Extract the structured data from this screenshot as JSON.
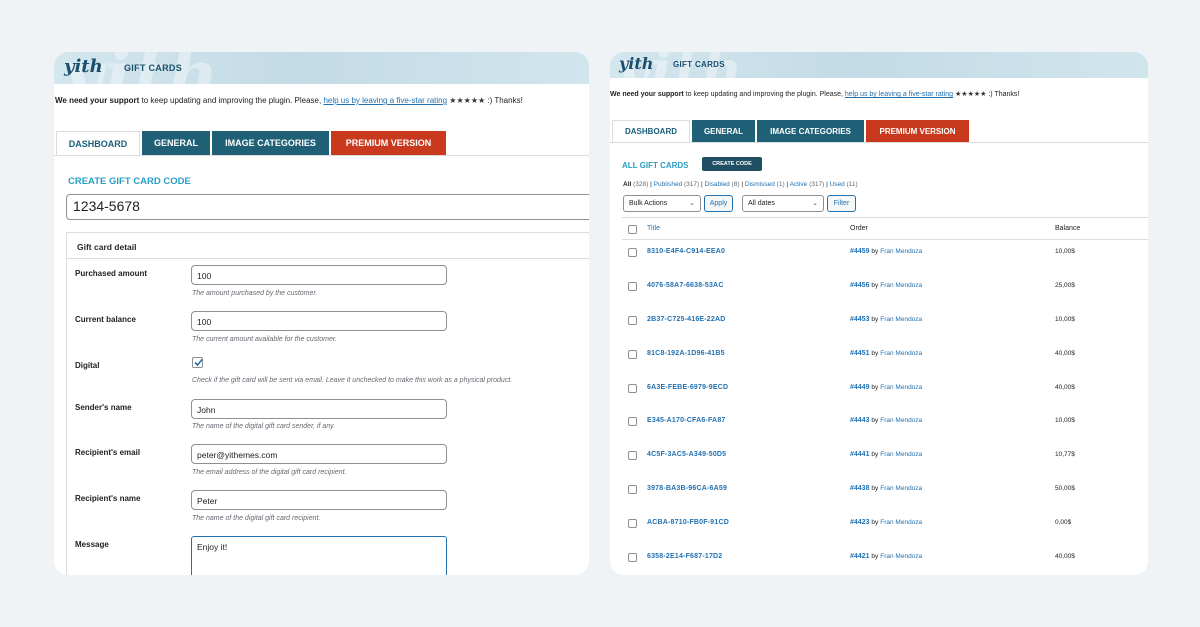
{
  "brand": {
    "logo": "yith",
    "deco": "yith"
  },
  "left": {
    "banner_title": "GIFT CARDS",
    "support": {
      "bold": "We need your support",
      "text": " to keep updating and improving the plugin. Please, ",
      "link": "help us by leaving a five-star rating",
      "stars": "★★★★★",
      "end": " :) Thanks!"
    },
    "tabs": [
      "DASHBOARD",
      "GENERAL",
      "IMAGE CATEGORIES",
      "PREMIUM VERSION"
    ],
    "section_title": "CREATE GIFT CARD CODE",
    "code_value": "1234-5678",
    "detail_title": "Gift card detail",
    "fields": {
      "purchased": {
        "label": "Purchased amount",
        "value": "100",
        "desc": "The amount purchased by the customer."
      },
      "balance": {
        "label": "Current balance",
        "value": "100",
        "desc": "The current amount available for the customer."
      },
      "digital": {
        "label": "Digital",
        "checked": true,
        "desc": "Check if the gift card will be sent via email. Leave it unchecked to make this work as a physical product."
      },
      "sender": {
        "label": "Sender's name",
        "value": "John",
        "desc": "The name of the digital gift card sender, if any."
      },
      "recipient_email": {
        "label": "Recipient's email",
        "value": "peter@yithemes.com",
        "desc": "The email address of the digital gift card recipient."
      },
      "recipient_name": {
        "label": "Recipient's name",
        "value": "Peter",
        "desc": "The name of the digital gift card recipient."
      },
      "message": {
        "label": "Message",
        "value": "Enjoy it!"
      }
    }
  },
  "right": {
    "banner_title": "GIFT CARDS",
    "support": {
      "bold": "We need your support",
      "text": " to keep updating and improving the plugin. Please, ",
      "link": "help us by leaving a five-star rating",
      "stars": "★★★★★",
      "end": " :) Thanks!"
    },
    "tabs": [
      "DASHBOARD",
      "GENERAL",
      "IMAGE CATEGORIES",
      "PREMIUM VERSION"
    ],
    "list_title": "ALL GIFT CARDS",
    "create_button": "CREATE CODE",
    "filters": [
      {
        "label": "All",
        "count": "(328)"
      },
      {
        "label": "Published",
        "count": "(317)"
      },
      {
        "label": "Disabled",
        "count": "(8)"
      },
      {
        "label": "Dismissed",
        "count": "(1)"
      },
      {
        "label": "Active",
        "count": "(317)"
      },
      {
        "label": "Used",
        "count": "(11)"
      }
    ],
    "bulk_actions": "Bulk Actions",
    "apply": "Apply",
    "all_dates": "All dates",
    "filter": "Filter",
    "columns": {
      "title": "Title",
      "order": "Order",
      "balance": "Balance"
    },
    "rows": [
      {
        "code": "8310-E4F4-C914-EEA0",
        "order": "#4459",
        "by": "by",
        "customer": "Fran Mendoza",
        "balance": "10,00$"
      },
      {
        "code": "4076-58A7-6638-53AC",
        "order": "#4456",
        "by": "by",
        "customer": "Fran Mendoza",
        "balance": "25,00$"
      },
      {
        "code": "2B37-C725-416E-22AD",
        "order": "#4453",
        "by": "by",
        "customer": "Fran Mendoza",
        "balance": "10,00$"
      },
      {
        "code": "81C8-192A-1D96-41B5",
        "order": "#4451",
        "by": "by",
        "customer": "Fran Mendoza",
        "balance": "40,00$"
      },
      {
        "code": "6A3E-FEBE-6979-9ECD",
        "order": "#4449",
        "by": "by",
        "customer": "Fran Mendoza",
        "balance": "40,00$"
      },
      {
        "code": "E345-A170-CFA6-FA87",
        "order": "#4443",
        "by": "by",
        "customer": "Fran Mendoza",
        "balance": "10,00$"
      },
      {
        "code": "4C5F-3AC5-A349-50D5",
        "order": "#4441",
        "by": "by",
        "customer": "Fran Mendoza",
        "balance": "10,77$"
      },
      {
        "code": "3978-BA3B-96CA-6A59",
        "order": "#4438",
        "by": "by",
        "customer": "Fran Mendoza",
        "balance": "50,00$"
      },
      {
        "code": "ACBA-8710-FB0F-91CD",
        "order": "#4423",
        "by": "by",
        "customer": "Fran Mendoza",
        "balance": "0,00$"
      },
      {
        "code": "6358-2E14-F687-17D2",
        "order": "#4421",
        "by": "by",
        "customer": "Fran Mendoza",
        "balance": "40,00$"
      }
    ]
  }
}
